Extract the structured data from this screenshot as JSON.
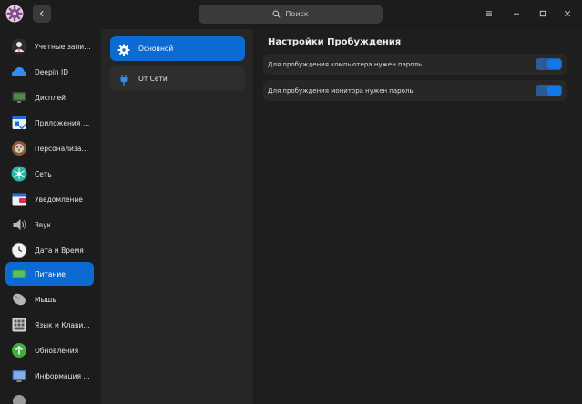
{
  "titlebar": {
    "search_placeholder": "Поиск"
  },
  "sidebar": {
    "items": [
      {
        "label": "Учетные записи",
        "icon": "user-accounts-icon"
      },
      {
        "label": "Deepin ID",
        "icon": "cloud-icon"
      },
      {
        "label": "Дисплей",
        "icon": "display-icon"
      },
      {
        "label": "Приложения по умолчанию",
        "icon": "default-apps-icon"
      },
      {
        "label": "Персонализация",
        "icon": "personalization-icon"
      },
      {
        "label": "Сеть",
        "icon": "network-icon"
      },
      {
        "label": "Уведомление",
        "icon": "notification-icon"
      },
      {
        "label": "Звук",
        "icon": "speaker-icon"
      },
      {
        "label": "Дата и Время",
        "icon": "clock-icon"
      },
      {
        "label": "Питание",
        "icon": "battery-icon"
      },
      {
        "label": "Мышь",
        "icon": "mouse-icon"
      },
      {
        "label": "Язык и Клавиатура",
        "icon": "keyboard-icon"
      },
      {
        "label": "Обновления",
        "icon": "update-icon"
      },
      {
        "label": "Информация о системе",
        "icon": "system-info-icon"
      }
    ],
    "active_index": 9
  },
  "subnav": {
    "items": [
      {
        "label": "Основной",
        "icon": "gear-icon"
      },
      {
        "label": "От Сети",
        "icon": "plug-icon"
      }
    ],
    "active_index": 0
  },
  "content": {
    "title": "Настройки Пробуждения",
    "settings": [
      {
        "label": "Для пробуждения компьютера нужен пароль",
        "enabled": true
      },
      {
        "label": "Для пробуждения монитора нужен пароль",
        "enabled": true
      }
    ]
  },
  "colors": {
    "accent": "#0b6bd3",
    "toggle_on": "#1477e6"
  }
}
